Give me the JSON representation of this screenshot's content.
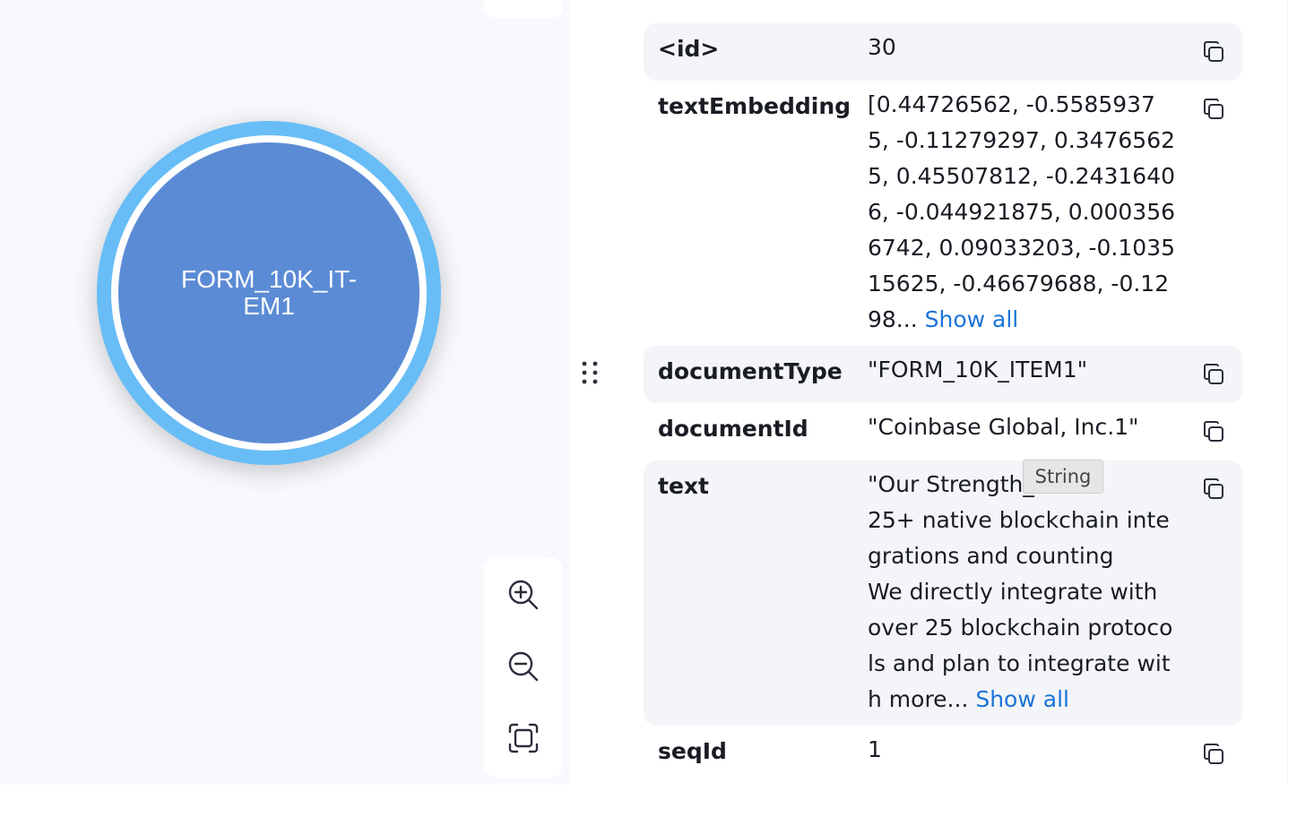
{
  "graph": {
    "node": {
      "label": "FORM_10K_IT-\nEM1",
      "core_color": "#5b8bd5",
      "ring_color": "#68bdf6"
    },
    "zoom_controls": {
      "zoom_in_icon": "magnifier-plus-icon",
      "zoom_out_icon": "magnifier-minus-icon",
      "fit_icon": "fit-to-screen-icon"
    }
  },
  "properties": {
    "copy_icon": "copy-icon",
    "show_all_label": "Show all",
    "rows": [
      {
        "key": "<id>",
        "value": "30"
      },
      {
        "key": "textEmbedding",
        "value": "[0.44726562, -0.55859375, -0.11279297, 0.34765625, 0.45507812, -0.24316406, -0.044921875, 0.0003566742, 0.09033203, -0.103515625, -0.46679688, -0.1298...",
        "truncated": true
      },
      {
        "key": "documentType",
        "value": "\"FORM_10K_ITEM1\""
      },
      {
        "key": "documentId",
        "value": "\"Coinbase Global, Inc.1\""
      },
      {
        "key": "text",
        "value": "\"Our Strength_\n25+ native blockchain integrations and counting\nWe directly integrate with over 25 blockchain protocols and plan to integrate with more...",
        "truncated": true
      },
      {
        "key": "seqId",
        "value": "1"
      }
    ],
    "tooltip": "String"
  },
  "colors": {
    "link": "#1a73d9",
    "row_shade": "#f4f5f8"
  }
}
